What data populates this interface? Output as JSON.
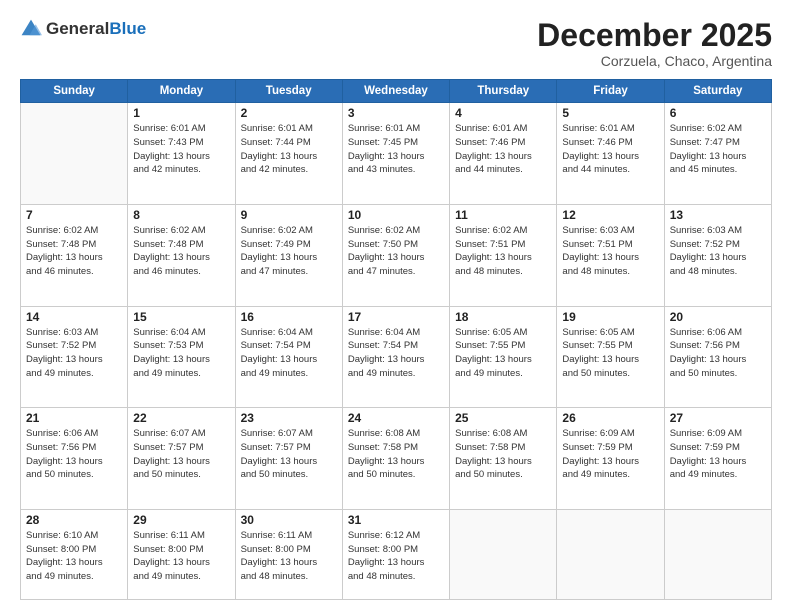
{
  "header": {
    "logo": {
      "text_general": "General",
      "text_blue": "Blue"
    },
    "title": "December 2025",
    "location": "Corzuela, Chaco, Argentina"
  },
  "calendar": {
    "days_of_week": [
      "Sunday",
      "Monday",
      "Tuesday",
      "Wednesday",
      "Thursday",
      "Friday",
      "Saturday"
    ],
    "weeks": [
      [
        {
          "day": "",
          "content": []
        },
        {
          "day": "1",
          "content": [
            "Sunrise: 6:01 AM",
            "Sunset: 7:43 PM",
            "Daylight: 13 hours",
            "and 42 minutes."
          ]
        },
        {
          "day": "2",
          "content": [
            "Sunrise: 6:01 AM",
            "Sunset: 7:44 PM",
            "Daylight: 13 hours",
            "and 42 minutes."
          ]
        },
        {
          "day": "3",
          "content": [
            "Sunrise: 6:01 AM",
            "Sunset: 7:45 PM",
            "Daylight: 13 hours",
            "and 43 minutes."
          ]
        },
        {
          "day": "4",
          "content": [
            "Sunrise: 6:01 AM",
            "Sunset: 7:46 PM",
            "Daylight: 13 hours",
            "and 44 minutes."
          ]
        },
        {
          "day": "5",
          "content": [
            "Sunrise: 6:01 AM",
            "Sunset: 7:46 PM",
            "Daylight: 13 hours",
            "and 44 minutes."
          ]
        },
        {
          "day": "6",
          "content": [
            "Sunrise: 6:02 AM",
            "Sunset: 7:47 PM",
            "Daylight: 13 hours",
            "and 45 minutes."
          ]
        }
      ],
      [
        {
          "day": "7",
          "content": [
            "Sunrise: 6:02 AM",
            "Sunset: 7:48 PM",
            "Daylight: 13 hours",
            "and 46 minutes."
          ]
        },
        {
          "day": "8",
          "content": [
            "Sunrise: 6:02 AM",
            "Sunset: 7:48 PM",
            "Daylight: 13 hours",
            "and 46 minutes."
          ]
        },
        {
          "day": "9",
          "content": [
            "Sunrise: 6:02 AM",
            "Sunset: 7:49 PM",
            "Daylight: 13 hours",
            "and 47 minutes."
          ]
        },
        {
          "day": "10",
          "content": [
            "Sunrise: 6:02 AM",
            "Sunset: 7:50 PM",
            "Daylight: 13 hours",
            "and 47 minutes."
          ]
        },
        {
          "day": "11",
          "content": [
            "Sunrise: 6:02 AM",
            "Sunset: 7:51 PM",
            "Daylight: 13 hours",
            "and 48 minutes."
          ]
        },
        {
          "day": "12",
          "content": [
            "Sunrise: 6:03 AM",
            "Sunset: 7:51 PM",
            "Daylight: 13 hours",
            "and 48 minutes."
          ]
        },
        {
          "day": "13",
          "content": [
            "Sunrise: 6:03 AM",
            "Sunset: 7:52 PM",
            "Daylight: 13 hours",
            "and 48 minutes."
          ]
        }
      ],
      [
        {
          "day": "14",
          "content": [
            "Sunrise: 6:03 AM",
            "Sunset: 7:52 PM",
            "Daylight: 13 hours",
            "and 49 minutes."
          ]
        },
        {
          "day": "15",
          "content": [
            "Sunrise: 6:04 AM",
            "Sunset: 7:53 PM",
            "Daylight: 13 hours",
            "and 49 minutes."
          ]
        },
        {
          "day": "16",
          "content": [
            "Sunrise: 6:04 AM",
            "Sunset: 7:54 PM",
            "Daylight: 13 hours",
            "and 49 minutes."
          ]
        },
        {
          "day": "17",
          "content": [
            "Sunrise: 6:04 AM",
            "Sunset: 7:54 PM",
            "Daylight: 13 hours",
            "and 49 minutes."
          ]
        },
        {
          "day": "18",
          "content": [
            "Sunrise: 6:05 AM",
            "Sunset: 7:55 PM",
            "Daylight: 13 hours",
            "and 49 minutes."
          ]
        },
        {
          "day": "19",
          "content": [
            "Sunrise: 6:05 AM",
            "Sunset: 7:55 PM",
            "Daylight: 13 hours",
            "and 50 minutes."
          ]
        },
        {
          "day": "20",
          "content": [
            "Sunrise: 6:06 AM",
            "Sunset: 7:56 PM",
            "Daylight: 13 hours",
            "and 50 minutes."
          ]
        }
      ],
      [
        {
          "day": "21",
          "content": [
            "Sunrise: 6:06 AM",
            "Sunset: 7:56 PM",
            "Daylight: 13 hours",
            "and 50 minutes."
          ]
        },
        {
          "day": "22",
          "content": [
            "Sunrise: 6:07 AM",
            "Sunset: 7:57 PM",
            "Daylight: 13 hours",
            "and 50 minutes."
          ]
        },
        {
          "day": "23",
          "content": [
            "Sunrise: 6:07 AM",
            "Sunset: 7:57 PM",
            "Daylight: 13 hours",
            "and 50 minutes."
          ]
        },
        {
          "day": "24",
          "content": [
            "Sunrise: 6:08 AM",
            "Sunset: 7:58 PM",
            "Daylight: 13 hours",
            "and 50 minutes."
          ]
        },
        {
          "day": "25",
          "content": [
            "Sunrise: 6:08 AM",
            "Sunset: 7:58 PM",
            "Daylight: 13 hours",
            "and 50 minutes."
          ]
        },
        {
          "day": "26",
          "content": [
            "Sunrise: 6:09 AM",
            "Sunset: 7:59 PM",
            "Daylight: 13 hours",
            "and 49 minutes."
          ]
        },
        {
          "day": "27",
          "content": [
            "Sunrise: 6:09 AM",
            "Sunset: 7:59 PM",
            "Daylight: 13 hours",
            "and 49 minutes."
          ]
        }
      ],
      [
        {
          "day": "28",
          "content": [
            "Sunrise: 6:10 AM",
            "Sunset: 8:00 PM",
            "Daylight: 13 hours",
            "and 49 minutes."
          ]
        },
        {
          "day": "29",
          "content": [
            "Sunrise: 6:11 AM",
            "Sunset: 8:00 PM",
            "Daylight: 13 hours",
            "and 49 minutes."
          ]
        },
        {
          "day": "30",
          "content": [
            "Sunrise: 6:11 AM",
            "Sunset: 8:00 PM",
            "Daylight: 13 hours",
            "and 48 minutes."
          ]
        },
        {
          "day": "31",
          "content": [
            "Sunrise: 6:12 AM",
            "Sunset: 8:00 PM",
            "Daylight: 13 hours",
            "and 48 minutes."
          ]
        },
        {
          "day": "",
          "content": []
        },
        {
          "day": "",
          "content": []
        },
        {
          "day": "",
          "content": []
        }
      ]
    ]
  }
}
